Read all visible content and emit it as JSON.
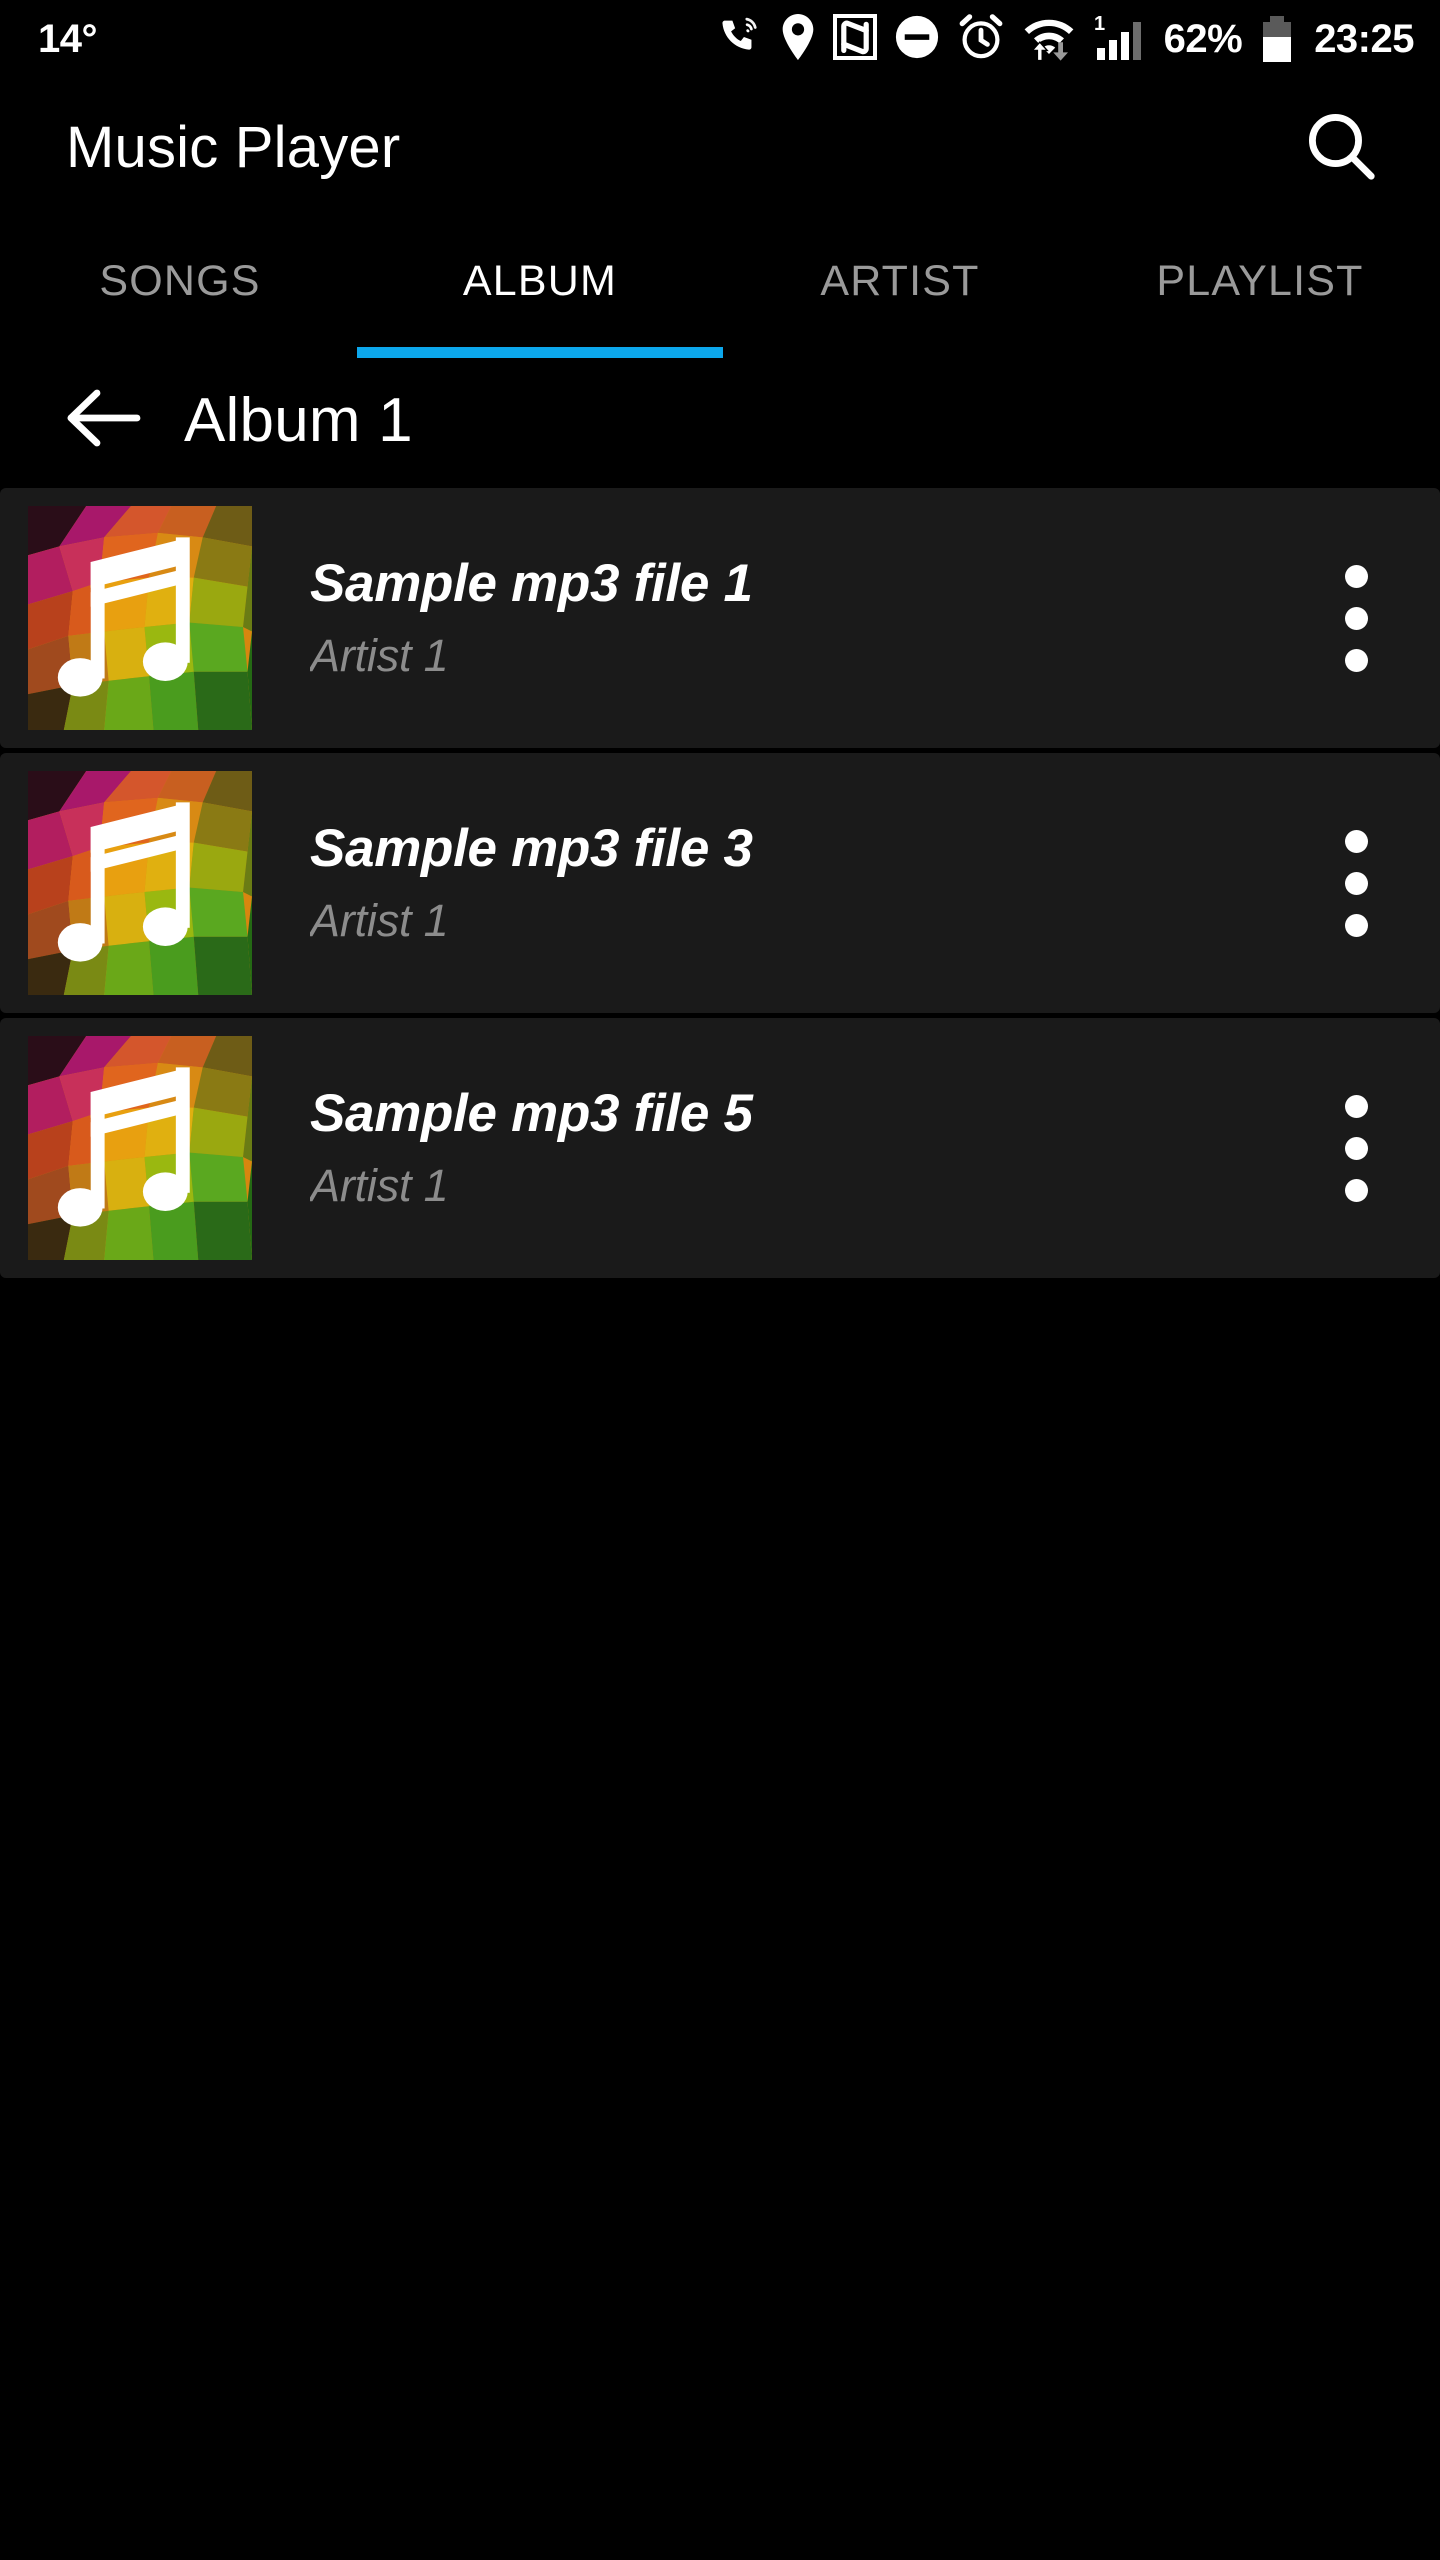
{
  "status_bar": {
    "temperature": "14°",
    "battery_percent": "62%",
    "clock": "23:25",
    "signal_superscript": "1",
    "icons": [
      "phone-call-signal-icon",
      "location-pin-icon",
      "nfc-icon",
      "do-not-disturb-icon",
      "alarm-clock-icon",
      "wifi-data-transfer-icon",
      "cellular-signal-icon",
      "battery-icon"
    ]
  },
  "app_bar": {
    "title": "Music Player",
    "search_icon": "search-icon"
  },
  "tabs": {
    "active_index": 1,
    "indicator_color": "#0ca7ec",
    "items": [
      {
        "label": "SONGS"
      },
      {
        "label": "ALBUM"
      },
      {
        "label": "ARTIST"
      },
      {
        "label": "PLAYLIST"
      }
    ]
  },
  "album_header": {
    "back_icon": "arrow-left-icon",
    "title": "Album 1"
  },
  "songs": [
    {
      "title": "Sample mp3 file 1",
      "artist": "Artist 1",
      "artwork": "music-note-lowpoly-art",
      "overflow_icon": "more-vertical-icon"
    },
    {
      "title": "Sample mp3 file 3",
      "artist": "Artist 1",
      "artwork": "music-note-lowpoly-art",
      "overflow_icon": "more-vertical-icon"
    },
    {
      "title": "Sample mp3 file 5",
      "artist": "Artist 1",
      "artwork": "music-note-lowpoly-art",
      "overflow_icon": "more-vertical-icon"
    }
  ],
  "colors": {
    "background": "#000000",
    "row_background": "#1a1a1a",
    "accent": "#0ca7ec",
    "primary_text": "#ffffff",
    "secondary_text": "#8c8c8c",
    "inactive_tab_text": "#9a9a9a"
  }
}
